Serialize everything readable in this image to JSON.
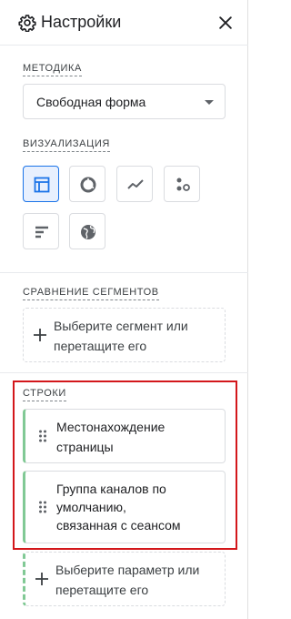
{
  "header": {
    "title": "Настройки",
    "icon": "gear-icon",
    "close_icon": "close-icon"
  },
  "methodology": {
    "label": "МЕТОДИКА",
    "selected": "Свободная форма"
  },
  "visualization": {
    "label": "ВИЗУАЛИЗАЦИЯ",
    "options": [
      {
        "icon": "table-icon",
        "active": true
      },
      {
        "icon": "donut-chart-icon",
        "active": false
      },
      {
        "icon": "line-chart-icon",
        "active": false
      },
      {
        "icon": "scatter-icon",
        "active": false
      },
      {
        "icon": "bar-chart-icon",
        "active": false
      },
      {
        "icon": "globe-icon",
        "active": false
      }
    ]
  },
  "segments": {
    "label": "СРАВНЕНИЕ СЕГМЕНТОВ",
    "placeholder_line1": "Выберите сегмент или",
    "placeholder_line2": "перетащите его"
  },
  "rows": {
    "label": "СТРОКИ",
    "items": [
      {
        "line1": "Местонахождение",
        "line2": "страницы"
      },
      {
        "line1": "Группа каналов по",
        "line2": "умолчанию,",
        "line3": "связанная с сеансом"
      }
    ],
    "placeholder_line1": "Выберите параметр или",
    "placeholder_line2": "перетащите его"
  },
  "colors": {
    "accent": "#1a73e8",
    "row_chip": "#81c995",
    "highlight": "#d3171b"
  }
}
